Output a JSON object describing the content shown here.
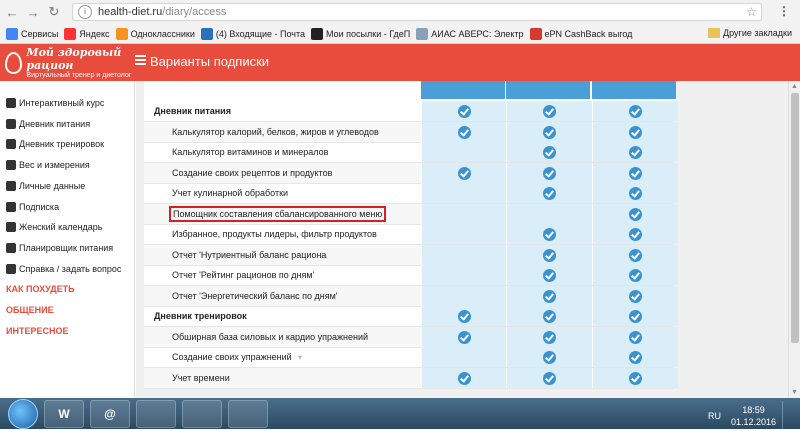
{
  "browser": {
    "url_host": "health-diet.ru",
    "url_path": "/diary/access",
    "bookmarks": [
      {
        "label": "Сервисы",
        "color": "#4285f4"
      },
      {
        "label": "Яндекс",
        "color": "#ff3333"
      },
      {
        "label": "Одноклассники",
        "color": "#f7931e"
      },
      {
        "label": "(4) Входящие - Почта",
        "color": "#2c6fbb"
      },
      {
        "label": "Мои посылки - ГдеП",
        "color": "#222222"
      },
      {
        "label": "АИАС АВЕРС: Электр",
        "color": "#8aa0b8"
      },
      {
        "label": "ePN CashBack выгод",
        "color": "#d83a2f"
      }
    ],
    "other_bookmarks": "Другие закладки"
  },
  "header": {
    "logo_title": "Мой здоровый рацион",
    "logo_subtitle": "Виртуальный тренер и диетолог",
    "title": "Варианты подписки",
    "brand_color": "#e84c3d"
  },
  "sidebar": {
    "items": [
      {
        "label": "Интерактивный курс",
        "icon": "gallery-icon"
      },
      {
        "label": "Дневник питания",
        "icon": "fork-knife-icon"
      },
      {
        "label": "Дневник тренировок",
        "icon": "dumbbell-icon"
      },
      {
        "label": "Вес и измерения",
        "icon": "scale-icon"
      },
      {
        "label": "Личные данные",
        "icon": "user-icon"
      },
      {
        "label": "Подписка",
        "icon": "lock-icon"
      },
      {
        "label": "Женский календарь",
        "icon": "calendar-icon"
      },
      {
        "label": "Планировщик питания",
        "icon": "planner-icon"
      },
      {
        "label": "Справка / задать вопрос",
        "icon": "question-icon"
      }
    ],
    "links": [
      "КАК ПОХУДЕТЬ",
      "ОБЩЕНИЕ",
      "ИНТЕРЕСНОЕ"
    ]
  },
  "table": {
    "rows": [
      {
        "label": "Дневник питания",
        "section": true,
        "checks": [
          true,
          true,
          true
        ]
      },
      {
        "label": "Калькулятор калорий, белков, жиров и углеводов",
        "section": false,
        "checks": [
          true,
          true,
          true
        ]
      },
      {
        "label": "Калькулятор витаминов и минералов",
        "section": false,
        "checks": [
          false,
          true,
          true
        ]
      },
      {
        "label": "Создание своих рецептов и продуктов",
        "section": false,
        "checks": [
          true,
          true,
          true
        ]
      },
      {
        "label": "Учет кулинарной обработки",
        "section": false,
        "checks": [
          false,
          true,
          true
        ]
      },
      {
        "label": "Помощник составления сбалансированного меню",
        "section": false,
        "highlight": true,
        "checks": [
          false,
          false,
          true
        ]
      },
      {
        "label": "Избранное, продукты лидеры, фильтр продуктов",
        "section": false,
        "checks": [
          false,
          true,
          true
        ]
      },
      {
        "label": "Отчет 'Нутриентный баланс рациона",
        "section": false,
        "checks": [
          false,
          true,
          true
        ]
      },
      {
        "label": "Отчет 'Рейтинг рационов по дням'",
        "section": false,
        "checks": [
          false,
          true,
          true
        ]
      },
      {
        "label": "Отчет 'Энергетический баланс по дням'",
        "section": false,
        "checks": [
          false,
          true,
          true
        ]
      },
      {
        "label": "Дневник тренировок",
        "section": true,
        "checks": [
          true,
          true,
          true
        ]
      },
      {
        "label": "Обширная база силовых и кардио упражнений",
        "section": false,
        "checks": [
          true,
          true,
          true
        ]
      },
      {
        "label": "Создание своих упражнений",
        "section": false,
        "chevron": true,
        "checks": [
          false,
          true,
          true
        ]
      },
      {
        "label": "Учет времени",
        "section": false,
        "checks": [
          true,
          true,
          true
        ]
      }
    ]
  },
  "taskbar": {
    "apps": [
      "W",
      "@",
      "",
      "",
      ""
    ],
    "lang": "RU",
    "time": "18:59",
    "date": "01.12.2016"
  }
}
